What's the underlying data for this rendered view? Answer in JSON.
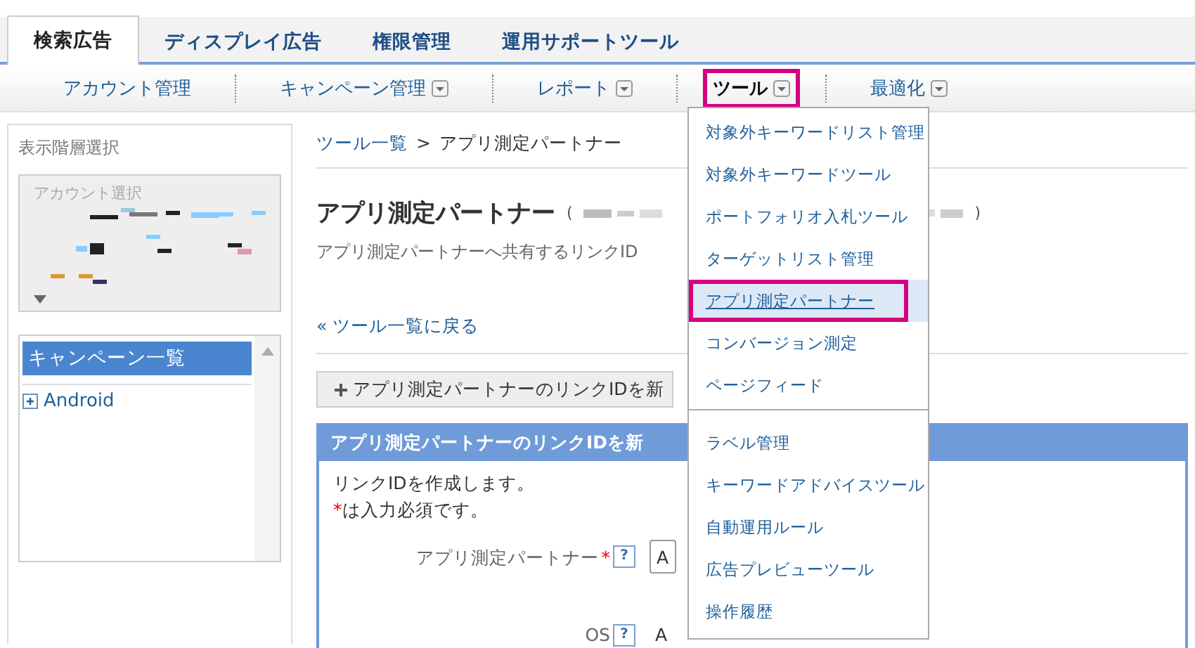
{
  "tabs": [
    {
      "label": "検索広告",
      "selected": true
    },
    {
      "label": "ディスプレイ広告",
      "selected": false
    },
    {
      "label": "権限管理",
      "selected": false
    },
    {
      "label": "運用サポートツール",
      "selected": false
    }
  ],
  "nav": [
    {
      "label": "アカウント管理",
      "has_menu": false,
      "selected": false
    },
    {
      "label": "キャンペーン管理",
      "has_menu": true,
      "selected": false
    },
    {
      "label": "レポート",
      "has_menu": true,
      "selected": false
    },
    {
      "label": "ツール",
      "has_menu": true,
      "selected": true
    },
    {
      "label": "最適化",
      "has_menu": true,
      "selected": false
    }
  ],
  "sidebar": {
    "label": "表示階層選択",
    "account_select": {
      "placeholder": "アカウント選択"
    },
    "campaign_list": {
      "header": "キャンペーン一覧",
      "items": [
        {
          "label": "Android",
          "expanded": false
        }
      ]
    }
  },
  "breadcrumb": {
    "link": "ツール一覧",
    "separator": ">",
    "current": "アプリ測定パートナー"
  },
  "title": "アプリ測定パートナー",
  "title_open": "(",
  "title_close": ")",
  "description": "アプリ測定パートナーへ共有するリンクID",
  "back_link": "« ツール一覧に戻る",
  "add_button": "アプリ測定パートナーのリンクIDを新",
  "form": {
    "header": "アプリ測定パートナーのリンクIDを新",
    "intro": "リンクIDを作成します。",
    "required_mark": "*",
    "required_note": "は入力必須です。",
    "fields": [
      {
        "label": "アプリ測定パートナー",
        "required": true,
        "help": "?",
        "value": "A",
        "kind": "select"
      },
      {
        "label": "OS",
        "required": false,
        "help": "?",
        "value": "A",
        "kind": "text"
      }
    ]
  },
  "menu": {
    "groups": [
      [
        {
          "label": "対象外キーワードリスト管理",
          "selected": false
        },
        {
          "label": "対象外キーワードツール",
          "selected": false
        },
        {
          "label": "ポートフォリオ入札ツール",
          "selected": false
        },
        {
          "label": "ターゲットリスト管理",
          "selected": false
        },
        {
          "label": "アプリ測定パートナー",
          "selected": true
        },
        {
          "label": "コンバージョン測定",
          "selected": false
        },
        {
          "label": "ページフィード",
          "selected": false
        }
      ],
      [
        {
          "label": "ラベル管理",
          "selected": false
        },
        {
          "label": "キーワードアドバイスツール",
          "selected": false
        },
        {
          "label": "自動運用ルール",
          "selected": false
        },
        {
          "label": "広告プレビューツール",
          "selected": false
        },
        {
          "label": "操作履歴",
          "selected": false
        }
      ]
    ]
  }
}
